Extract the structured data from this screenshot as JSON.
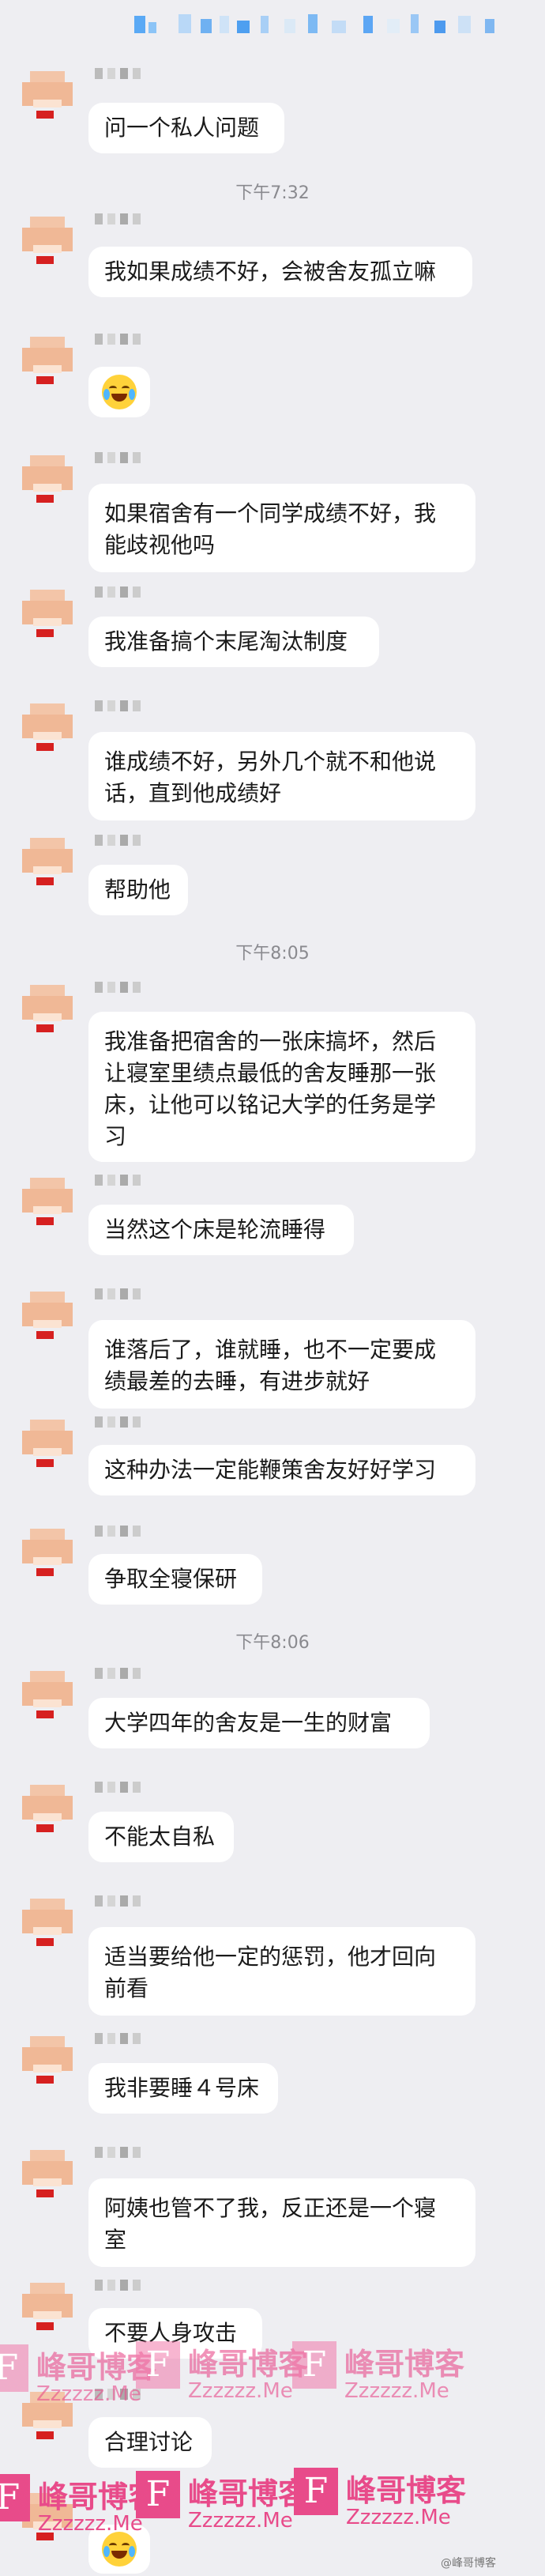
{
  "messages": [
    {
      "text": "问一个私人问题"
    },
    {
      "text": "我如果成绩不好，会被舍友孤立嘛"
    },
    {
      "emoji": "laughing-tears-emoji"
    },
    {
      "lines": [
        "如果宿舍有一个同学成绩不好，我",
        "能歧视他吗"
      ]
    },
    {
      "text": "我准备搞个末尾淘汰制度"
    },
    {
      "lines": [
        "谁成绩不好，另外几个就不和他说",
        "话，直到他成绩好"
      ]
    },
    {
      "text": "帮助他"
    },
    {
      "lines": [
        "我准备把宿舍的一张床搞坏，然后",
        "让寝室里绩点最低的舍友睡那一张",
        "床，让他可以铭记大学的任务是学",
        "习"
      ]
    },
    {
      "text": "当然这个床是轮流睡得"
    },
    {
      "lines": [
        "谁落后了，谁就睡，也不一定要成",
        "绩最差的去睡，有进步就好"
      ]
    },
    {
      "text": "这种办法一定能鞭策舍友好好学习"
    },
    {
      "text": "争取全寝保研"
    },
    {
      "text": "大学四年的舍友是一生的财富"
    },
    {
      "text": "不能太自私"
    },
    {
      "lines": [
        "适当要给他一定的惩罚，他才回向",
        "前看"
      ]
    },
    {
      "text": "我非要睡４号床"
    },
    {
      "lines": [
        "阿姨也管不了我，反正还是一个寝",
        "室"
      ]
    },
    {
      "text": "不要人身攻击"
    },
    {
      "text": "合理讨论"
    },
    {
      "emoji": "laughing-tears-emoji"
    }
  ],
  "timestamps": [
    "下午7:32",
    "下午8:05",
    "下午8:06"
  ],
  "watermark": {
    "logo": "F",
    "title": "峰哥博客",
    "url": "Zzzzzz.Me"
  },
  "credit": "@峰哥博客"
}
